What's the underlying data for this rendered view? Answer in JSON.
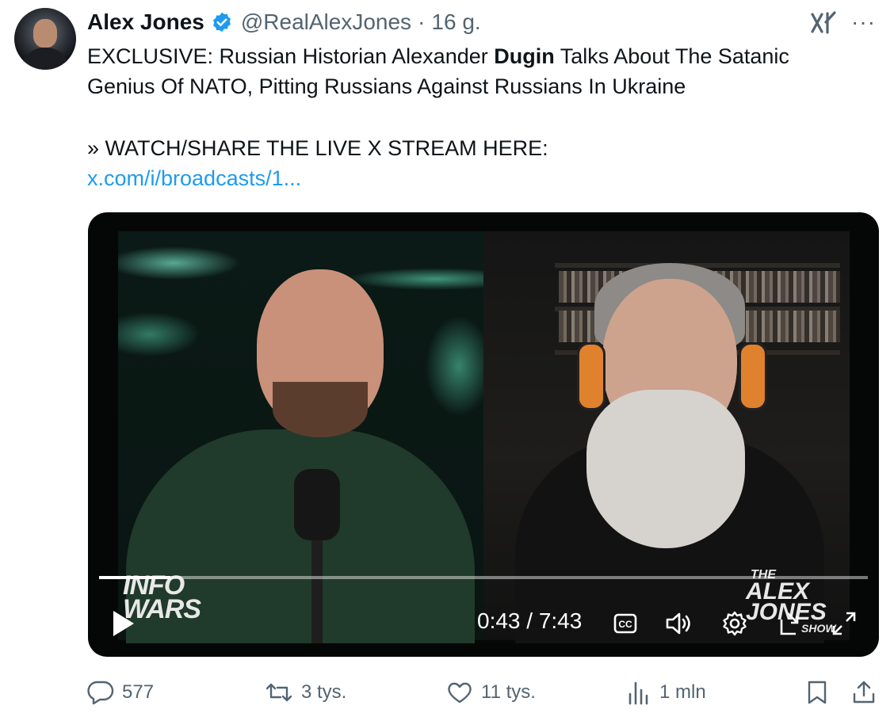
{
  "tweet": {
    "author_name": "Alex Jones",
    "handle": "@RealAlexJones",
    "separator": "·",
    "time_ago": "16 g.",
    "text_line1_before_bold": "EXCLUSIVE: Russian Historian Alexander ",
    "text_line1_bold": "Dugin",
    "text_line1_after_bold": " Talks About The Satanic",
    "text_line2": "Genius Of NATO, Pitting Russians Against Russians In Ukraine",
    "text_line3": "» WATCH/SHARE THE LIVE X STREAM HERE:",
    "link_text": "x.com/i/broadcasts/1..."
  },
  "video": {
    "current_time": "0:43",
    "duration": "7:43",
    "time_display": "0:43 / 7:43",
    "progress_fraction": 0.093,
    "overlay_logo_left": [
      "INFO",
      "WARS"
    ],
    "overlay_logo_right": [
      "THE",
      "ALEX",
      "JONES",
      "SHOW"
    ]
  },
  "actions": {
    "replies": "577",
    "reposts": "3 tys.",
    "likes": "11 tys.",
    "views": "1 mln"
  },
  "colors": {
    "link": "#1d9bf0",
    "verified_badge": "#1d9bf0",
    "secondary_text": "#536471",
    "primary_text": "#0f1419"
  },
  "icons": {
    "header_right": [
      "grok-icon",
      "more-icon"
    ],
    "video_controls": [
      "play-icon",
      "captions-icon",
      "volume-icon",
      "settings-icon",
      "minimize-icon",
      "fullscreen-icon"
    ],
    "actions": [
      "reply-icon",
      "repost-icon",
      "like-icon",
      "views-icon",
      "bookmark-icon",
      "share-icon"
    ]
  }
}
